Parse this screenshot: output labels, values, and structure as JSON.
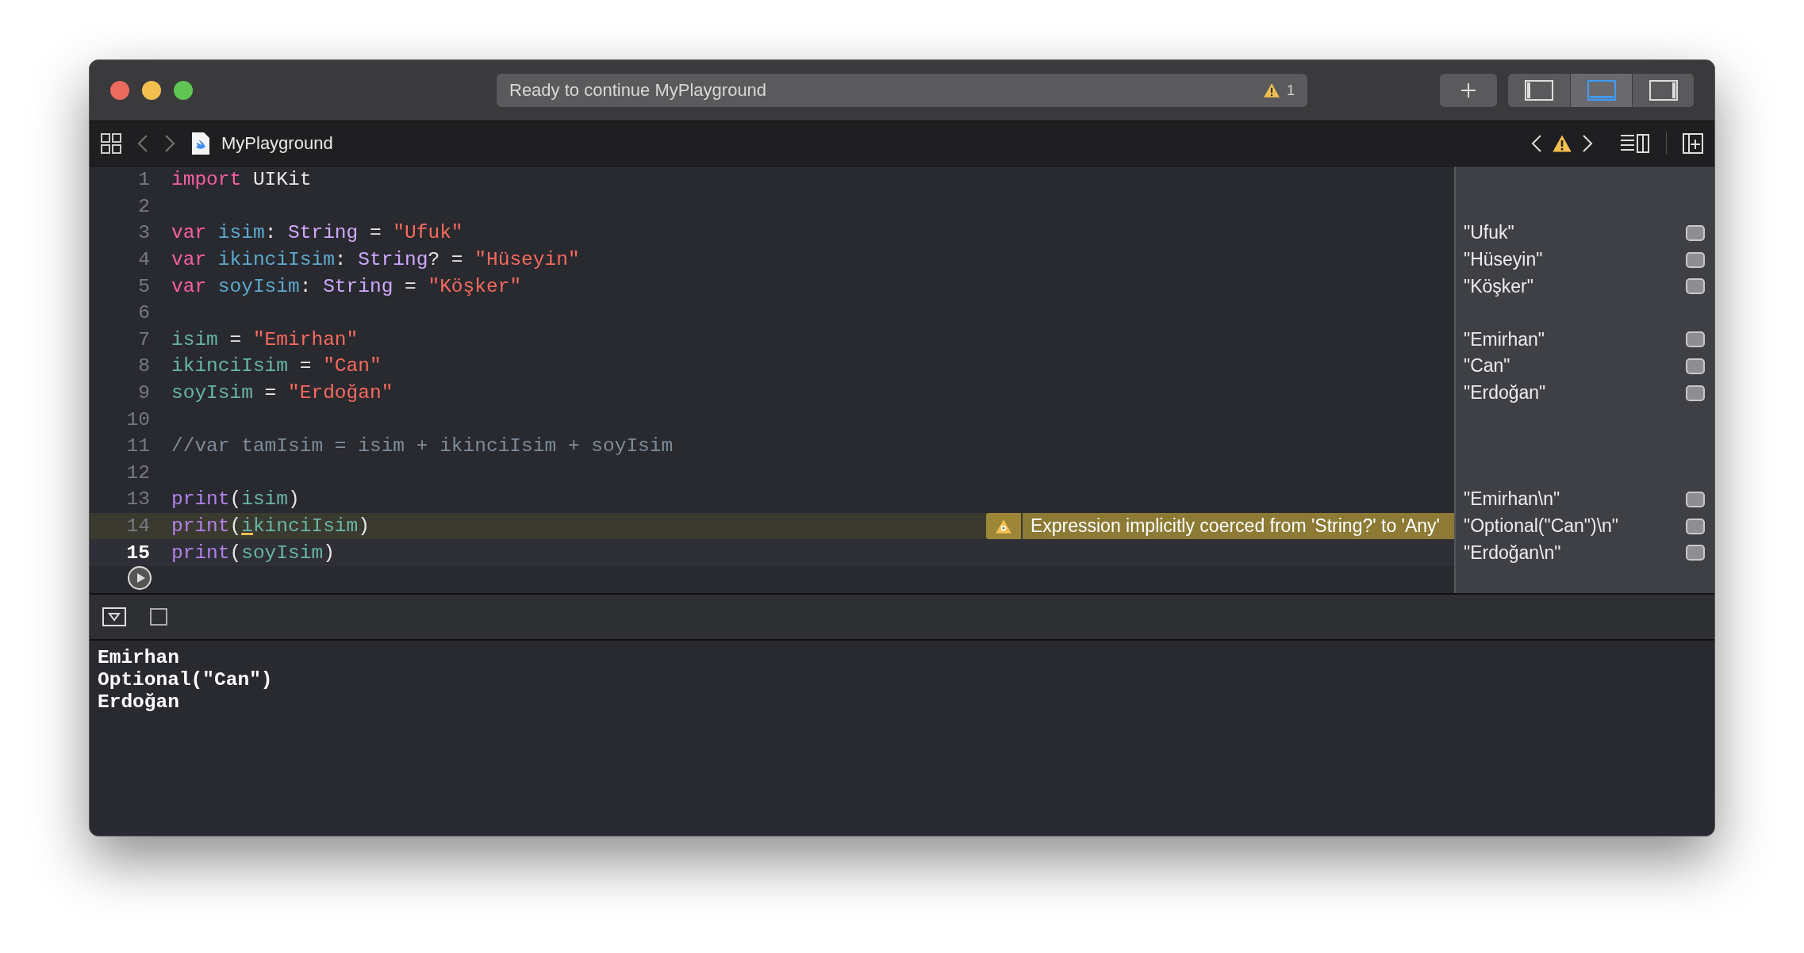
{
  "window": {
    "traffic_lights": [
      {
        "color": "#ed6a5e"
      },
      {
        "color": "#f5bf4f"
      },
      {
        "color": "#61c554"
      }
    ],
    "activity": {
      "text": "Ready to continue MyPlayground",
      "warning_count": "1"
    },
    "panel_toggles": [
      {
        "kind": "left",
        "selected": false
      },
      {
        "kind": "bottom",
        "selected": true
      },
      {
        "kind": "right",
        "selected": false
      }
    ]
  },
  "jump_bar": {
    "file": "MyPlayground"
  },
  "editor": {
    "lines": [
      {
        "number": "1",
        "current": false,
        "highlighted": false,
        "tokens": [
          {
            "kind": "keyword",
            "text": "import"
          },
          {
            "kind": "plain",
            "text": " UIKit"
          }
        ]
      },
      {
        "number": "2",
        "current": false,
        "highlighted": false
      },
      {
        "number": "3",
        "current": false,
        "highlighted": false,
        "result": "\"Ufuk\"",
        "tokens": [
          {
            "kind": "keyword",
            "text": "var"
          },
          {
            "kind": "decl",
            "text": " isim"
          },
          {
            "kind": "plain",
            "text": ": "
          },
          {
            "kind": "type",
            "text": "String"
          },
          {
            "kind": "plain",
            "text": " = "
          },
          {
            "kind": "string",
            "text": "\"Ufuk\""
          }
        ]
      },
      {
        "number": "4",
        "current": false,
        "highlighted": false,
        "result": "\"Hüseyin\"",
        "tokens": [
          {
            "kind": "keyword",
            "text": "var"
          },
          {
            "kind": "decl",
            "text": " ikinciIsim"
          },
          {
            "kind": "plain",
            "text": ": "
          },
          {
            "kind": "type",
            "text": "String"
          },
          {
            "kind": "plain",
            "text": "? = "
          },
          {
            "kind": "string",
            "text": "\"Hüseyin\""
          }
        ]
      },
      {
        "number": "5",
        "current": false,
        "highlighted": false,
        "result": "\"Köşker\"",
        "tokens": [
          {
            "kind": "keyword",
            "text": "var"
          },
          {
            "kind": "decl",
            "text": " soyIsim"
          },
          {
            "kind": "plain",
            "text": ": "
          },
          {
            "kind": "type",
            "text": "String"
          },
          {
            "kind": "plain",
            "text": " = "
          },
          {
            "kind": "string",
            "text": "\"Köşker\""
          }
        ]
      },
      {
        "number": "6",
        "current": false,
        "highlighted": false
      },
      {
        "number": "7",
        "current": false,
        "highlighted": false,
        "result": "\"Emirhan\"",
        "tokens": [
          {
            "kind": "variable",
            "text": "isim"
          },
          {
            "kind": "plain",
            "text": " = "
          },
          {
            "kind": "string",
            "text": "\"Emirhan\""
          }
        ]
      },
      {
        "number": "8",
        "current": false,
        "highlighted": false,
        "result": "\"Can\"",
        "tokens": [
          {
            "kind": "variable",
            "text": "ikinciIsim"
          },
          {
            "kind": "plain",
            "text": " = "
          },
          {
            "kind": "string",
            "text": "\"Can\""
          }
        ]
      },
      {
        "number": "9",
        "current": false,
        "highlighted": false,
        "result": "\"Erdoğan\"",
        "tokens": [
          {
            "kind": "variable",
            "text": "soyIsim"
          },
          {
            "kind": "plain",
            "text": " = "
          },
          {
            "kind": "string",
            "text": "\"Erdoğan\""
          }
        ]
      },
      {
        "number": "10",
        "current": false,
        "highlighted": false
      },
      {
        "number": "11",
        "current": false,
        "highlighted": false,
        "tokens": [
          {
            "kind": "comment",
            "text": "//var tamIsim = isim + ikinciIsim + soyIsim"
          }
        ]
      },
      {
        "number": "12",
        "current": false,
        "highlighted": false
      },
      {
        "number": "13",
        "current": false,
        "highlighted": false,
        "result": "\"Emirhan\\n\"",
        "tokens": [
          {
            "kind": "function",
            "text": "print"
          },
          {
            "kind": "plain",
            "text": "("
          },
          {
            "kind": "variable",
            "text": "isim"
          },
          {
            "kind": "plain",
            "text": ")"
          }
        ]
      },
      {
        "number": "14",
        "current": false,
        "highlighted": true,
        "result": "\"Optional(\"Can\")\\n\"",
        "warning": "Expression implicitly coerced from 'String?' to 'Any'",
        "tokens": [
          {
            "kind": "function",
            "text": "print"
          },
          {
            "kind": "plain",
            "text": "("
          },
          {
            "kind": "flagged",
            "text": "i"
          },
          {
            "kind": "variable",
            "text": "kinciIsim"
          },
          {
            "kind": "plain",
            "text": ")"
          }
        ]
      },
      {
        "number": "15",
        "current": true,
        "highlighted": false,
        "result": "\"Erdoğan\\n\"",
        "tokens": [
          {
            "kind": "function",
            "text": "print"
          },
          {
            "kind": "plain",
            "text": "("
          },
          {
            "kind": "variable",
            "text": "soyIsim"
          },
          {
            "kind": "plain",
            "text": ")"
          }
        ]
      }
    ]
  },
  "console": {
    "output": [
      "Emirhan",
      "Optional(\"Can\")",
      "Erdoğan"
    ]
  }
}
